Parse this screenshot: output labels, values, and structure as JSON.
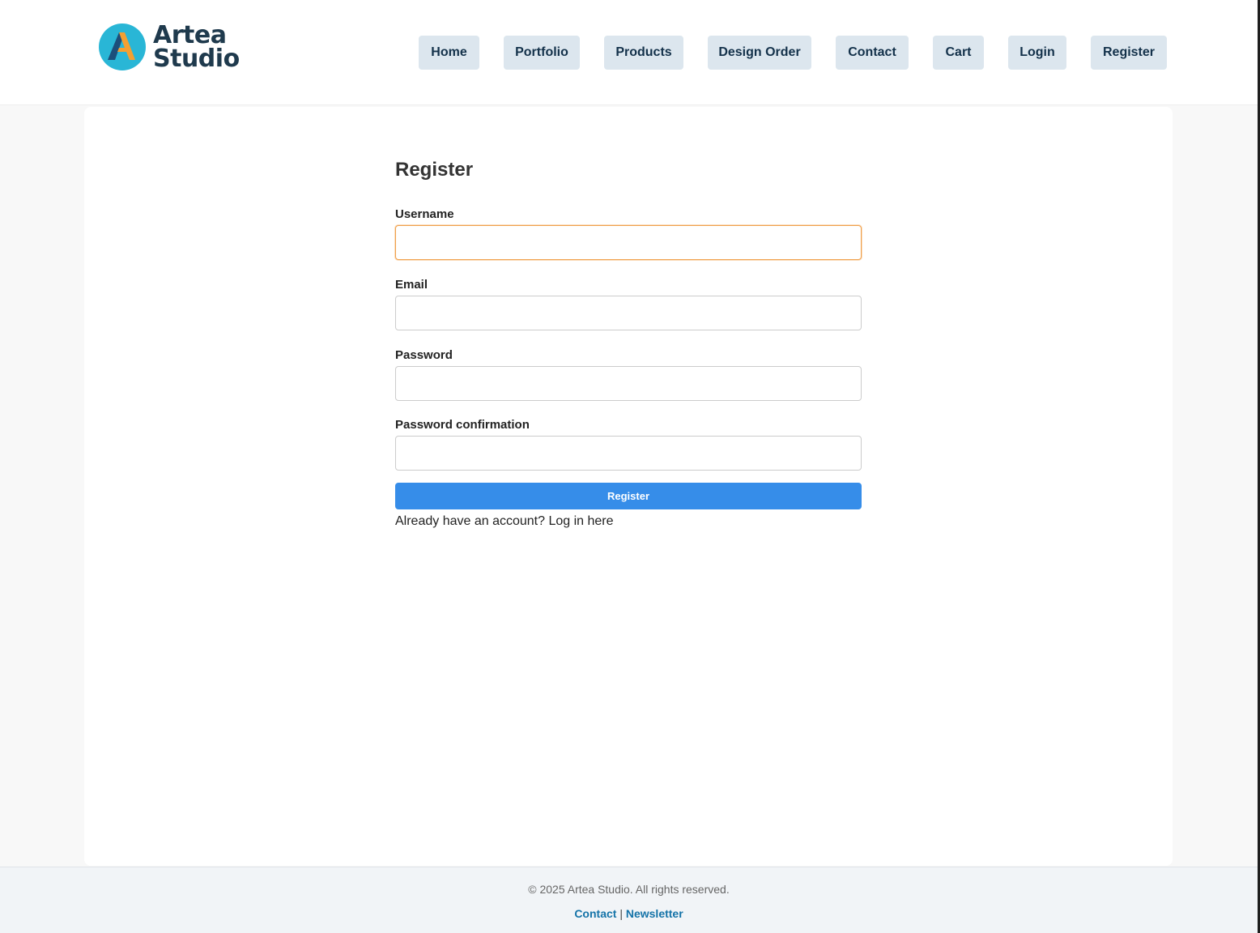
{
  "brand": {
    "name_line1": "Artea",
    "name_line2": "Studio",
    "logo_icon": "artea-a-logo-icon",
    "colors": {
      "circle": "#29b6d6",
      "a_dark": "#1c4e7a",
      "a_orange": "#f3a032",
      "text": "#1f3a4d"
    }
  },
  "nav": {
    "items": [
      {
        "label": "Home"
      },
      {
        "label": "Portfolio"
      },
      {
        "label": "Products"
      },
      {
        "label": "Design Order"
      },
      {
        "label": "Contact"
      },
      {
        "label": "Cart"
      },
      {
        "label": "Login"
      },
      {
        "label": "Register"
      }
    ]
  },
  "form": {
    "title": "Register",
    "fields": {
      "username": {
        "label": "Username",
        "value": "",
        "focused": true
      },
      "email": {
        "label": "Email",
        "value": ""
      },
      "password": {
        "label": "Password",
        "value": ""
      },
      "password_confirmation": {
        "label": "Password confirmation",
        "value": ""
      }
    },
    "submit_label": "Register",
    "login_prompt_text": "Already have an account?",
    "login_link_text": "Log in here"
  },
  "footer": {
    "copyright": "© 2025 Artea Studio. All rights reserved.",
    "links": [
      {
        "label": "Contact"
      },
      {
        "label": "Newsletter"
      }
    ],
    "separator": "|"
  },
  "colors": {
    "primary_button": "#368de9",
    "nav_button_bg": "#dce6ee",
    "nav_button_text": "#13314a",
    "focus_border": "#f0a04b",
    "footer_link": "#1473a8"
  }
}
